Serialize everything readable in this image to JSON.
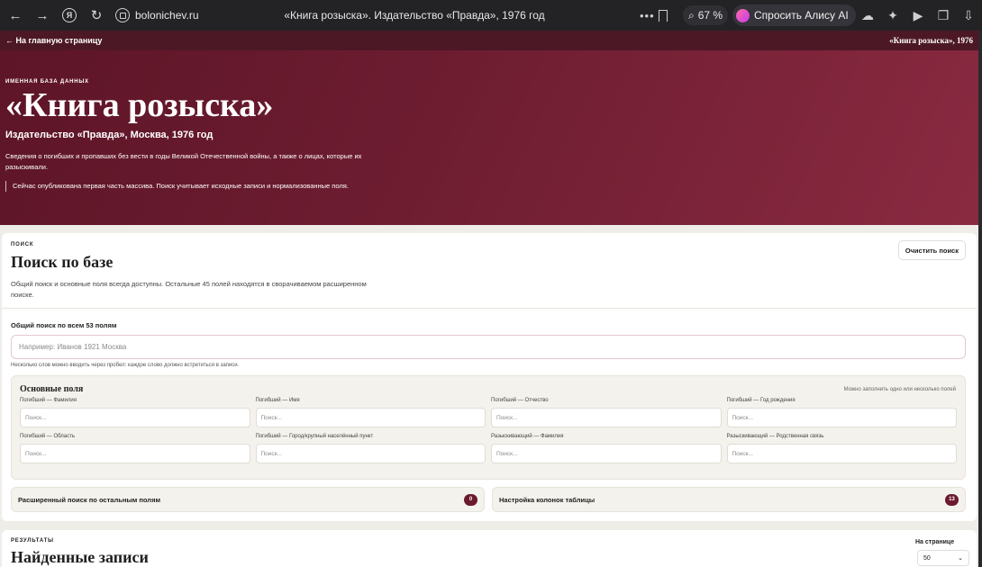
{
  "browser": {
    "domain": "bolonichev.ru",
    "tab_title": "«Книга розыска». Издательство «Правда», 1976 год",
    "zoom": "67 %",
    "alice_label": "Спросить Алису AI"
  },
  "topbar": {
    "back_link": "← На главную страницу",
    "right_title": "«Книга розыска», 1976"
  },
  "hero": {
    "eyebrow": "Именная база данных",
    "title": "«Книга розыска»",
    "subtitle": "Издательство «Правда», Москва, 1976 год",
    "description": "Сведения о погибших и пропавших без вести в годы Великой Отечественной войны, а также о лицах, которые их разыскивали.",
    "note": "Сейчас опубликована первая часть массива. Поиск учитывает исходные записи и нормализованные поля."
  },
  "search": {
    "kicker": "Поиск",
    "title": "Поиск по базе",
    "lead": "Общий поиск и основные поля всегда доступны. Остальные 45 полей находятся в сворачиваемом расширенном поиске.",
    "clear_button": "Очистить поиск",
    "global_label": "Общий поиск по всем 53 полям",
    "global_placeholder": "Например: Иванов 1921 Москва",
    "global_hint": "Несколько слов можно вводить через пробел: каждое слово должно встретиться в записи."
  },
  "fields": {
    "title": "Основные поля",
    "hint": "Можно заполнить одно или несколько полей",
    "items": [
      {
        "label": "Погибший — Фамилия",
        "placeholder": "Поиск..."
      },
      {
        "label": "Погибший — Имя",
        "placeholder": "Поиск..."
      },
      {
        "label": "Погибший — Отчество",
        "placeholder": "Поиск..."
      },
      {
        "label": "Погибший — Год рождения",
        "placeholder": "Поиск..."
      },
      {
        "label": "Погибший — Область",
        "placeholder": "Поиск..."
      },
      {
        "label": "Погибший — Город/крупный населённый пункт",
        "placeholder": "Поиск..."
      },
      {
        "label": "Разыскивающий — Фамилия",
        "placeholder": "Поиск..."
      },
      {
        "label": "Разыскивающий — Родственная связь",
        "placeholder": "Поиск..."
      }
    ]
  },
  "accordions": {
    "advanced_label": "Расширенный поиск по остальным полям",
    "advanced_count": "0",
    "columns_label": "Настройка колонок таблицы",
    "columns_count": "13"
  },
  "results": {
    "kicker": "Результаты",
    "title": "Найденные записи",
    "per_page_label": "На странице",
    "per_page_value": "50"
  }
}
